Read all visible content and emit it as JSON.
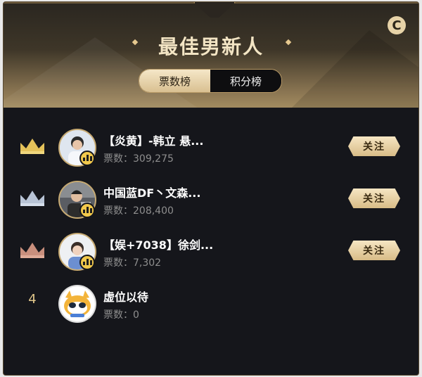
{
  "panel": {
    "title": "最佳男新人",
    "reset_icon_glyph": "C",
    "tabs": [
      {
        "label": "票数榜",
        "active": true
      },
      {
        "label": "积分榜",
        "active": false
      }
    ]
  },
  "ranking": [
    {
      "rank": 1,
      "rank_icon": "gold-crown-icon",
      "name": "【炎黄】-韩立 悬...",
      "votes": "票数：309,275",
      "live": true,
      "follow_label": "关注"
    },
    {
      "rank": 2,
      "rank_icon": "silver-crown-icon",
      "name": "中国蓝DF丶文森...",
      "votes": "票数：208,400",
      "live": true,
      "follow_label": "关注"
    },
    {
      "rank": 3,
      "rank_icon": "bronze-crown-icon",
      "name": "【娱+7038】徐剑...",
      "votes": "票数：7,302",
      "live": true,
      "follow_label": "关注"
    },
    {
      "rank": 4,
      "rank_label": "4",
      "name": "虚位以待",
      "votes": "票数：0",
      "live": false
    }
  ],
  "colors": {
    "panel_bg": "#15161b",
    "gold_accent": "#d9c091",
    "gold": "#e4c25a",
    "silver": "#b8c4d6",
    "bronze": "#c98f7d",
    "live_badge": "#f2c94c"
  }
}
